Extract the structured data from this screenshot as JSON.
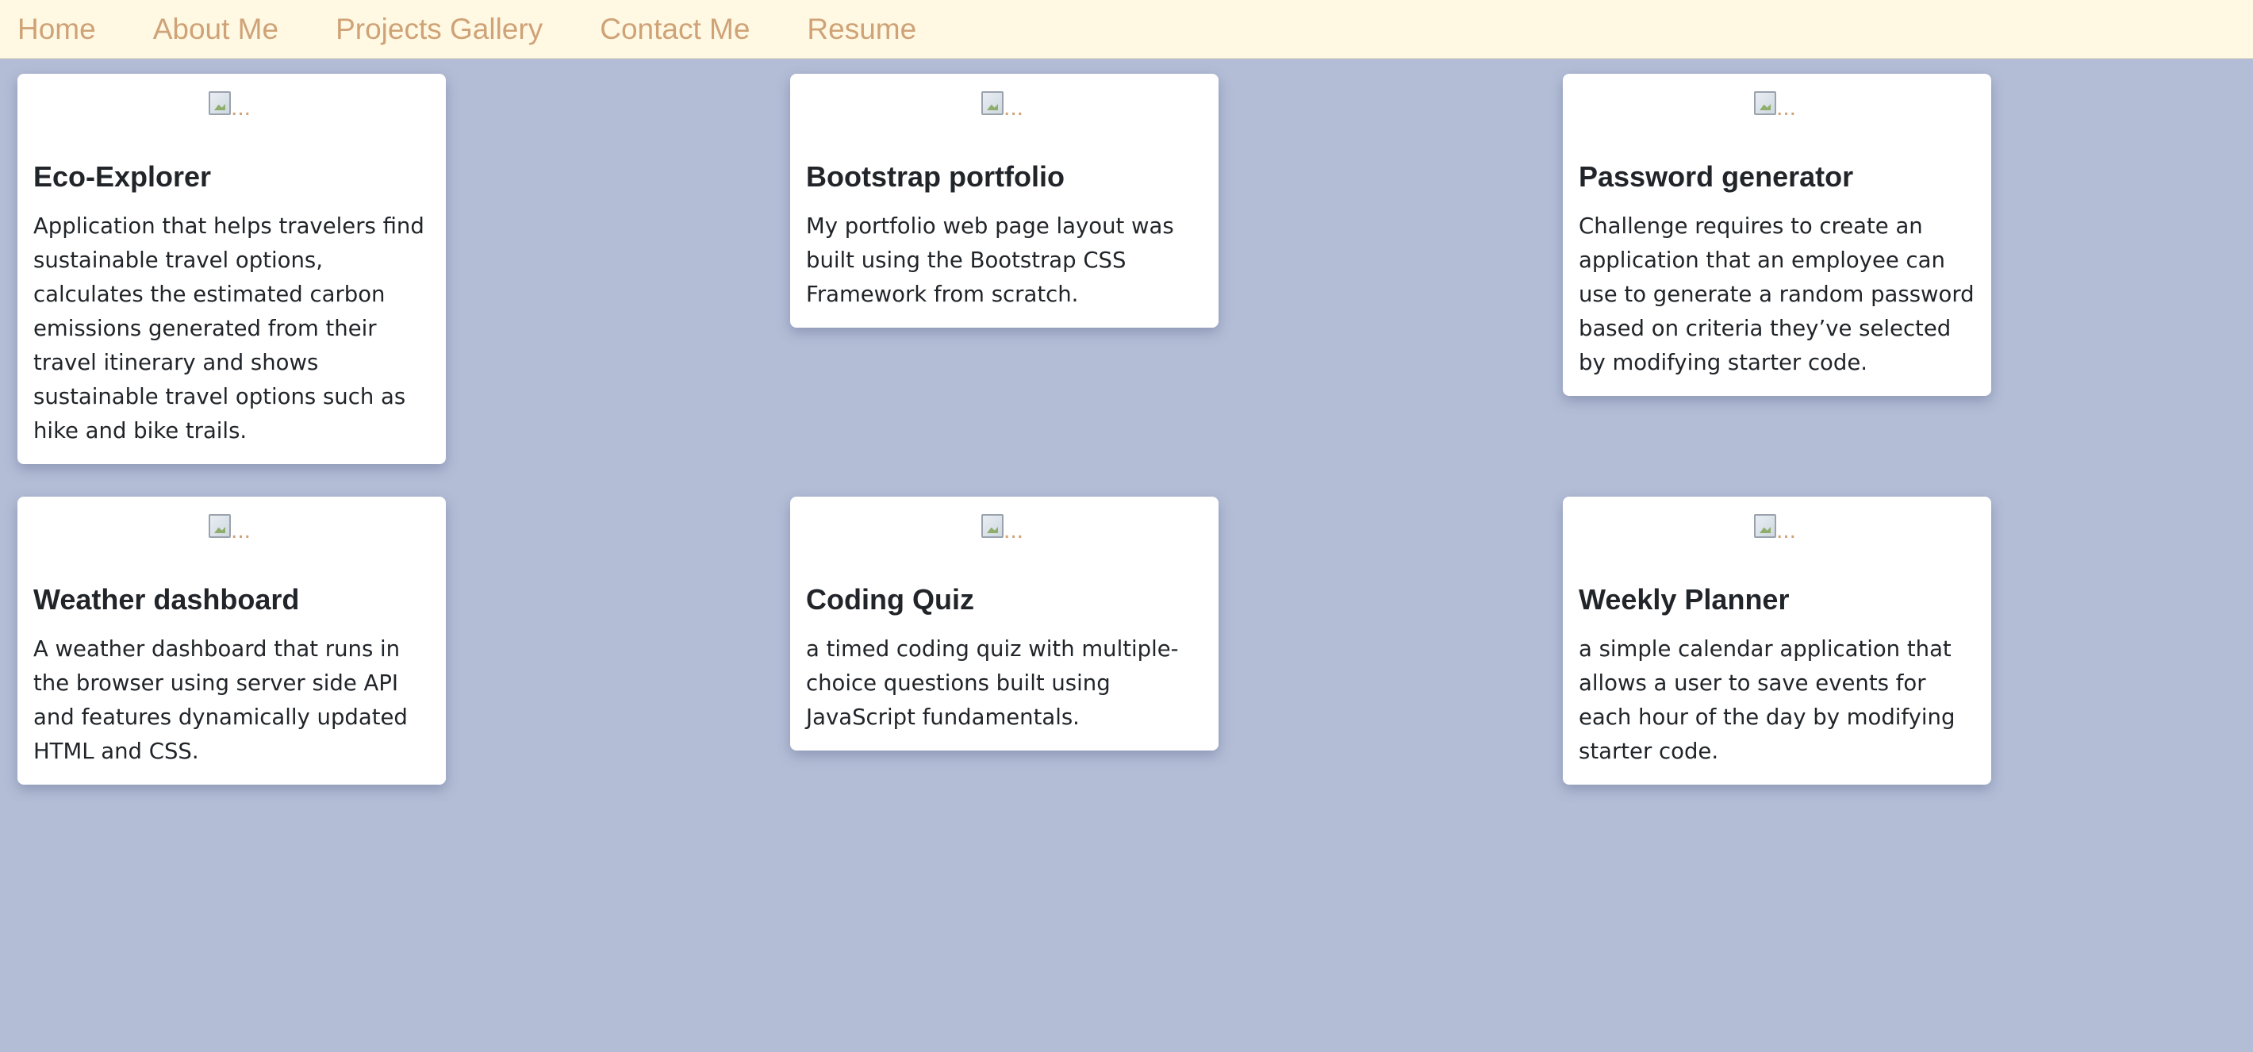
{
  "nav": {
    "items": [
      {
        "label": "Home"
      },
      {
        "label": "About Me"
      },
      {
        "label": "Projects Gallery"
      },
      {
        "label": "Contact Me"
      },
      {
        "label": "Resume"
      }
    ]
  },
  "cards": [
    {
      "img_alt": "...",
      "title": "Eco-Explorer",
      "text": "Application that helps travelers find sustainable travel options, calculates the estimated carbon emissions generated from their travel itinerary and shows sustainable travel options such as hike and bike trails."
    },
    {
      "img_alt": "...",
      "title": "Bootstrap portfolio",
      "text": "My portfolio web page layout was built using the Bootstrap CSS Framework from scratch."
    },
    {
      "img_alt": "...",
      "title": "Password generator",
      "text": "Challenge requires to create an application that an employee can use to generate a random password based on criteria they’ve selected by modifying starter code."
    },
    {
      "img_alt": "...",
      "title": "Weather dashboard",
      "text": "A weather dashboard that runs in the browser using server side API and features dynamically updated HTML and CSS."
    },
    {
      "img_alt": "...",
      "title": "Coding Quiz",
      "text": "a timed coding quiz with multiple-choice questions built using JavaScript fundamentals."
    },
    {
      "img_alt": "...",
      "title": "Weekly Planner",
      "text": "a simple calendar application that allows a user to save events for each hour of the day by modifying starter code."
    }
  ]
}
